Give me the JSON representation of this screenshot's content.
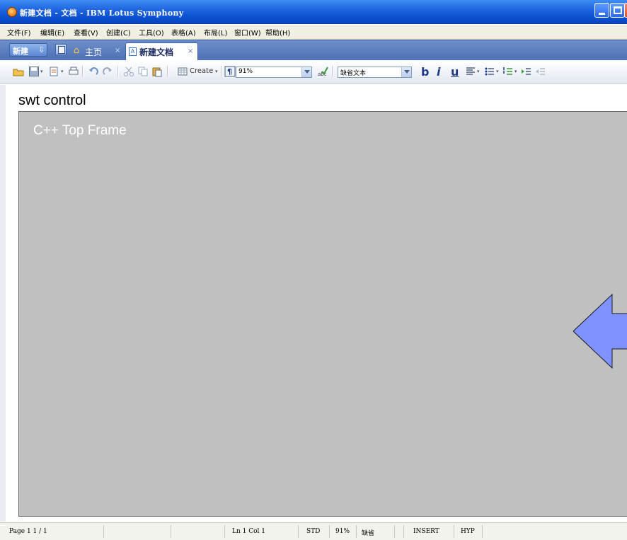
{
  "window": {
    "title": "新建文档 - 文档 - IBM Lotus Symphony"
  },
  "menu": {
    "items": [
      {
        "label": "文件(F)"
      },
      {
        "label": "编辑(E)"
      },
      {
        "label": "查看(V)"
      },
      {
        "label": "创建(C)"
      },
      {
        "label": "工具(O)"
      },
      {
        "label": "表格(A)"
      },
      {
        "label": "布局(L)"
      },
      {
        "label": "窗口(W)"
      },
      {
        "label": "帮助(H)"
      }
    ]
  },
  "tabs": {
    "new_label": "新建",
    "home_label": "主页",
    "doc_label": "新建文档",
    "close_glyph": "×",
    "doc_icon_glyph": "A"
  },
  "toolbar": {
    "create_label": "Create",
    "zoom_value": "91%",
    "style_value": "缺省文本",
    "bold_glyph": "b",
    "italic_glyph": "i",
    "underline_glyph": "u"
  },
  "content": {
    "swt_label": "swt control",
    "frame_title": "C++ Top Frame"
  },
  "statusbar": {
    "page": "Page 1  1 / 1",
    "position": "Ln 1 Col 1",
    "mode": "STD",
    "zoom": "91%",
    "style": "缺省",
    "insert": "INSERT",
    "hyp": "HYP"
  },
  "colors": {
    "titlebar": "#0b4fd0",
    "frame_bg": "#c0c0c0",
    "arrow_fill": "#7f92ff"
  }
}
